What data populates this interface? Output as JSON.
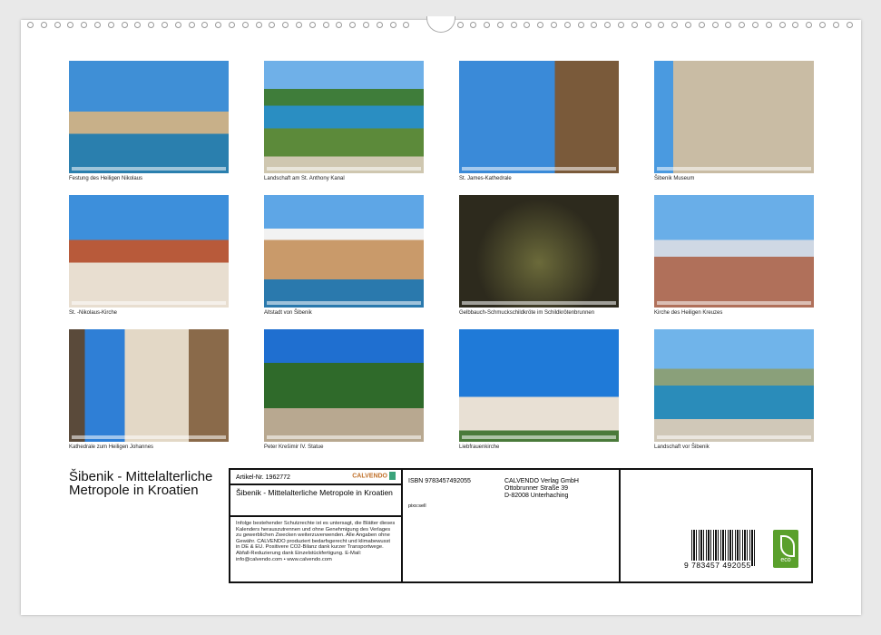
{
  "photos": [
    {
      "caption": "Festung des Heiligen Nikolaus"
    },
    {
      "caption": "Landschaft am St. Anthony Kanal"
    },
    {
      "caption": "St. James-Kathedrale"
    },
    {
      "caption": "Šibenik Museum"
    },
    {
      "caption": "St. -Nikolaus-Kirche"
    },
    {
      "caption": "Altstadt von Šibenik"
    },
    {
      "caption": "Gelbbauch-Schmuckschildkröte im Schildkrötenbrunnen"
    },
    {
      "caption": "Kirche des Heiligen Kreuzes"
    },
    {
      "caption": "Kathedrale zum Heiligen Johannes"
    },
    {
      "caption": "Peter Krešimir IV. Statue"
    },
    {
      "caption": "Liebfrauenkirche"
    },
    {
      "caption": "Landschaft vor Šibenik"
    }
  ],
  "title": "Šibenik - Mittelalterliche Metropole in Kroatien",
  "info": {
    "article": "Artikel-Nr. 1962772",
    "logo": "CALVENDO",
    "product_title": "Šibenik - Mittelalterliche Metropole in Kroatien",
    "legal": "Infolge bestehender Schutzrechte ist es untersagt, die Blätter dieses Kalenders herauszutrennen und ohne Genehmigung des Verlages zu gewerblichen Zwecken weiterzuverwenden. Alle Angaben ohne Gewähr. CALVENDO produziert bedarfsgerecht und klimabewusst in DE & EU. Positivere CO2-Bilanz dank kurzer Transportwege. Abfall-Reduzierung dank Einzelstückfertigung. E-Mail: info@calvendo.com • www.calvendo.com",
    "isbn": "ISBN 9783457492055",
    "author": "pixs:sell",
    "publisher": [
      "CALVENDO Verlag GmbH",
      "Ottobrunner Straße 39",
      "D-82008 Unterhaching"
    ],
    "barcode_number": "9 783457 492055",
    "eco_label": "eco"
  }
}
